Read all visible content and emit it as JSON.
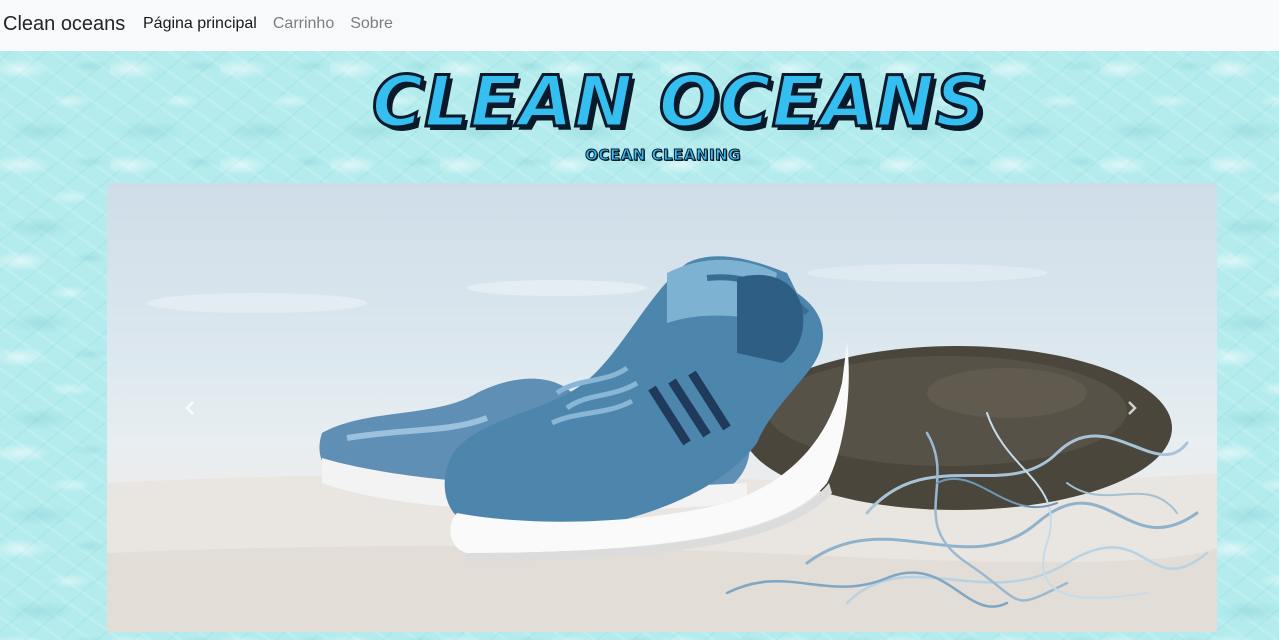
{
  "navbar": {
    "brand": "Clean oceans",
    "links": [
      {
        "label": "Página principal",
        "active": true
      },
      {
        "label": "Carrinho",
        "active": false
      },
      {
        "label": "Sobre",
        "active": false
      }
    ]
  },
  "banner": {
    "title": "CLEAN OCEANS",
    "subtitle": "OCEAN CLEANING"
  },
  "carousel": {
    "prev_icon": "chevron-left-icon",
    "next_icon": "chevron-right-icon",
    "slide_image": "sneaker-on-beach-with-fishing-net"
  },
  "colors": {
    "navbar_bg": "#f8f9fa",
    "water": "#b4ecee",
    "logo_fill": "#35bff0",
    "logo_outline": "#0b1a2b"
  }
}
